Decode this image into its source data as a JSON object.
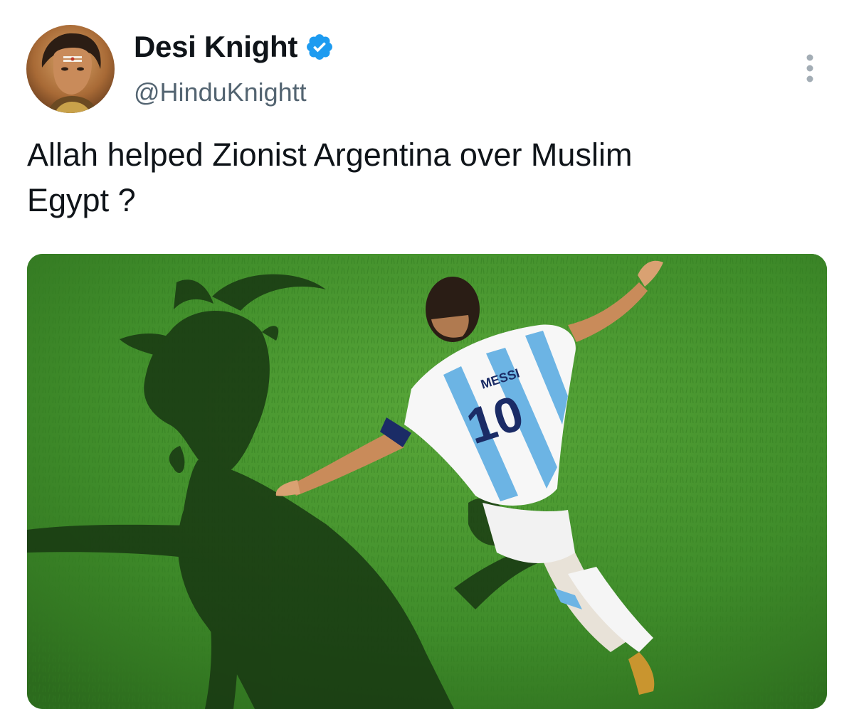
{
  "author": {
    "display_name": "Desi Knight",
    "handle": "@HinduKnightt",
    "verified": true,
    "verified_color": "#1d9bf0"
  },
  "tweet": {
    "text": "Allah helped Zionist Argentina over Muslim\nEgypt ?"
  },
  "media": {
    "jersey_name": "MESSI",
    "jersey_number": "10"
  },
  "icons": {
    "verified": "verified-badge-icon",
    "more": "more-options-icon"
  },
  "colors": {
    "text_primary": "#0f1419",
    "text_secondary": "#536471",
    "grass": "#3e8a2a",
    "jersey_blue": "#6cb4e4"
  }
}
